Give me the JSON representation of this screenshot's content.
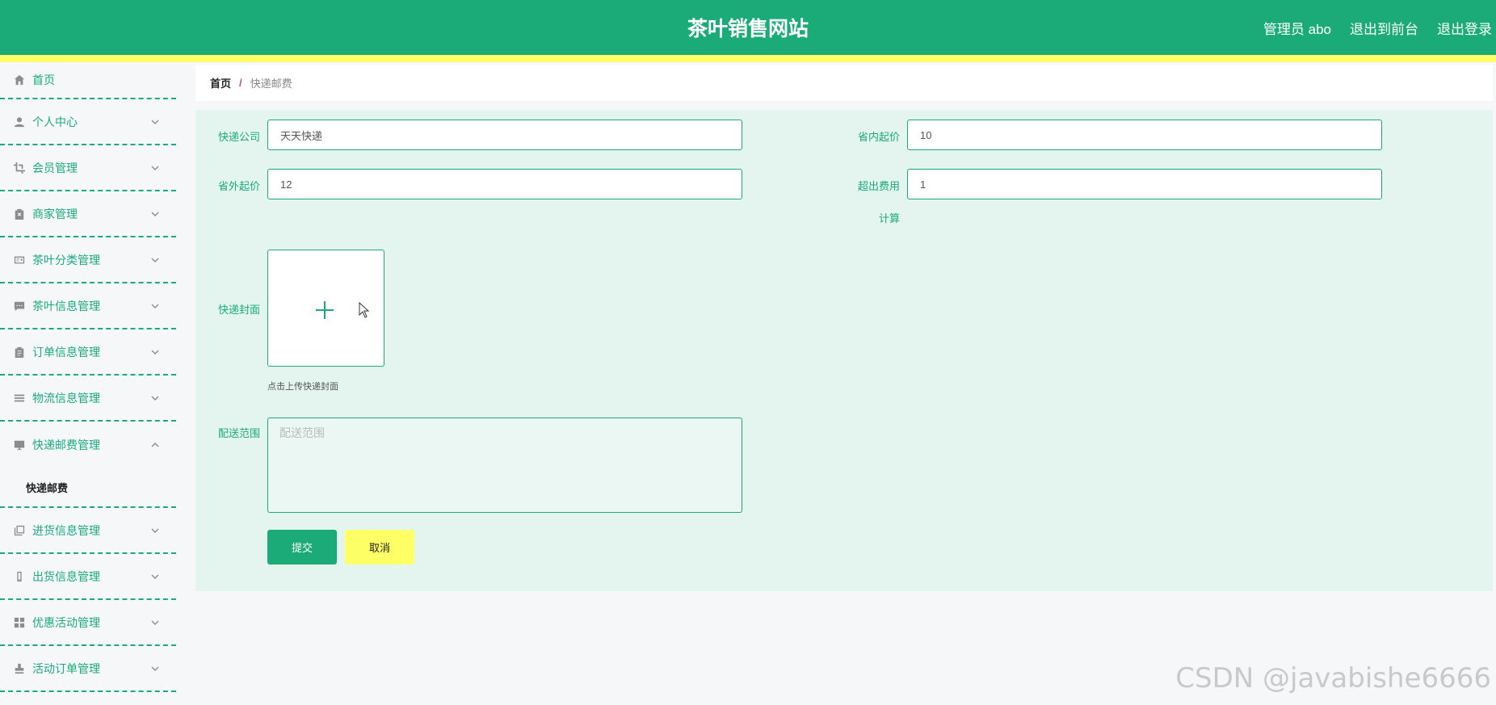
{
  "header": {
    "title": "茶叶销售网站",
    "user_label": "管理员 abo",
    "front_link": "退出到前台",
    "logout_link": "退出登录"
  },
  "sidebar": {
    "items": [
      {
        "label": "首页",
        "icon": "home-icon"
      },
      {
        "label": "个人中心",
        "icon": "user-icon"
      },
      {
        "label": "会员管理",
        "icon": "crop-icon"
      },
      {
        "label": "商家管理",
        "icon": "clipboard-x-icon"
      },
      {
        "label": "茶叶分类管理",
        "icon": "id-card-icon"
      },
      {
        "label": "茶叶信息管理",
        "icon": "chat-icon"
      },
      {
        "label": "订单信息管理",
        "icon": "clipboard-icon"
      },
      {
        "label": "物流信息管理",
        "icon": "list-icon"
      },
      {
        "label": "快递邮费管理",
        "icon": "monitor-icon"
      },
      {
        "label": "进货信息管理",
        "icon": "copy-icon"
      },
      {
        "label": "出货信息管理",
        "icon": "phone-icon"
      },
      {
        "label": "优惠活动管理",
        "icon": "grid-icon"
      },
      {
        "label": "活动订单管理",
        "icon": "stamp-icon"
      }
    ],
    "subitem": "快递邮费"
  },
  "breadcrumb": {
    "home": "首页",
    "separator": "/",
    "current": "快递邮费"
  },
  "form": {
    "company_label": "快递公司",
    "company_value": "天天快递",
    "in_province_label": "省内起价",
    "in_province_value": "10",
    "out_province_label": "省外起价",
    "out_province_value": "12",
    "extra_fee_label": "超出费用",
    "extra_fee_label2": "计算",
    "extra_fee_value": "1",
    "cover_label": "快递封面",
    "cover_hint": "点击上传快递封面",
    "range_label": "配送范围",
    "range_placeholder": "配送范围",
    "submit": "提交",
    "cancel": "取消"
  },
  "watermark": "CSDN @javabishe6666",
  "colors": {
    "primary": "#1aab79",
    "accent_yellow": "#ffff66",
    "panel": "#e4f4ee"
  }
}
